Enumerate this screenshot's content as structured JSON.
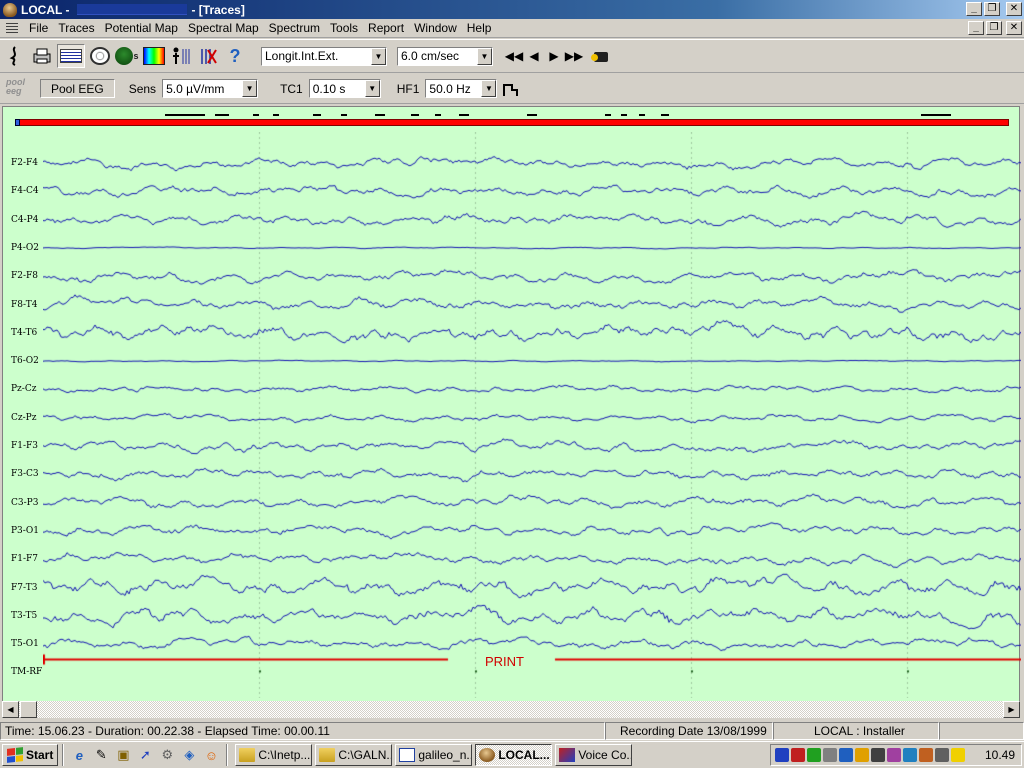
{
  "window": {
    "app_name": "LOCAL -",
    "doc_title": "- [Traces]",
    "controls": [
      "_",
      "❐",
      "✕"
    ]
  },
  "menu": {
    "items": [
      {
        "label": "File"
      },
      {
        "label": "Traces"
      },
      {
        "label": "Potential Map"
      },
      {
        "label": "Spectral Map"
      },
      {
        "label": "Spectrum"
      },
      {
        "label": "Tools"
      },
      {
        "label": "Report"
      },
      {
        "label": "Window"
      },
      {
        "label": "Help"
      }
    ]
  },
  "toolbar": {
    "icons": [
      "traces-view-icon",
      "print-icon",
      "traces-mode-icon",
      "potential-map-icon",
      "head-spectrum-icon",
      "spectral-map-icon",
      "channel-select-icon",
      "channel-exclude-icon",
      "help-icon"
    ],
    "montage": "Longit.Int.Ext.",
    "speed": "6.0 cm/sec",
    "nav": [
      "◀◀",
      "◀",
      "▶",
      "▶▶"
    ]
  },
  "toolbar2": {
    "pool_logo_line1": "pool",
    "pool_logo_line2": "eeg",
    "pool_button": "Pool EEG",
    "sens_label": "Sens",
    "sens_value": "5.0 µV/mm",
    "tc_label": "TC1",
    "tc_value": "0.10 s",
    "hf_label": "HF1",
    "hf_value": "50.0 Hz"
  },
  "traces": {
    "background": "#ccffcc",
    "trace_color": "#1010b0",
    "channels": [
      {
        "label": "F2-F4",
        "activity": "normal"
      },
      {
        "label": "F4-C4",
        "activity": "normal"
      },
      {
        "label": "C4-P4",
        "activity": "normal"
      },
      {
        "label": "P4-O2",
        "activity": "flat"
      },
      {
        "label": "F2-F8",
        "activity": "normal"
      },
      {
        "label": "F8-T4",
        "activity": "normal"
      },
      {
        "label": "T4-T6",
        "activity": "high"
      },
      {
        "label": "T6-O2",
        "activity": "flat"
      },
      {
        "label": "Pz-Cz",
        "activity": "low"
      },
      {
        "label": "Cz-Pz",
        "activity": "low"
      },
      {
        "label": "F1-F3",
        "activity": "normal"
      },
      {
        "label": "F3-C3",
        "activity": "normal"
      },
      {
        "label": "C3-P3",
        "activity": "normal"
      },
      {
        "label": "P3-O1",
        "activity": "normal"
      },
      {
        "label": "F1-F7",
        "activity": "normal"
      },
      {
        "label": "F7-T3",
        "activity": "high"
      },
      {
        "label": "T3-T5",
        "activity": "high"
      },
      {
        "label": "T5-O1",
        "activity": "normal"
      },
      {
        "label": "TM-RF",
        "activity": "marker"
      }
    ],
    "print_label": "PRINT"
  },
  "status": {
    "time": "Time: 15.06.23",
    "duration": "- Duration: 00.22.38",
    "elapsed": "- Elapsed Time: 00.00.11",
    "recording_date": "Recording Date 13/08/1999",
    "user": "LOCAL : Installer"
  },
  "taskbar": {
    "start": "Start",
    "quick_launch": [
      "ie-icon",
      "notepad-icon",
      "clipboard-icon",
      "cursor-icon",
      "gear-icon",
      "media-icon",
      "figure-icon"
    ],
    "tasks": [
      {
        "label": "C:\\Inetp...",
        "icon": "folder"
      },
      {
        "label": "C:\\GALN...",
        "icon": "folder"
      },
      {
        "label": "galileo_n...",
        "icon": "word"
      },
      {
        "label": "LOCAL...",
        "icon": "eeg",
        "active": true
      },
      {
        "label": "Voice Co...",
        "icon": "voice"
      }
    ],
    "clock": "10.49"
  }
}
